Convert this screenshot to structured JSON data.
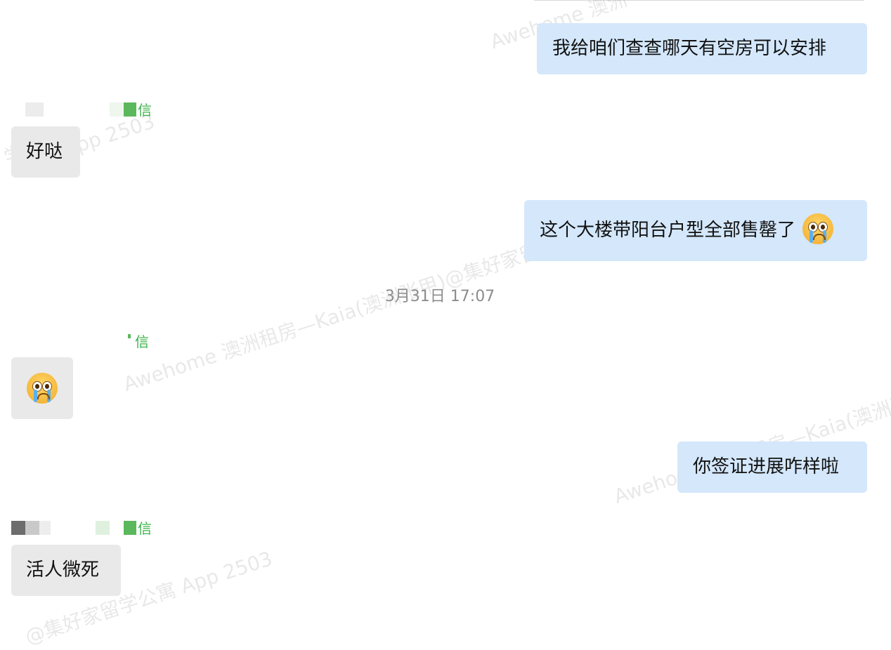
{
  "conversation": {
    "messages": [
      {
        "direction": "outgoing",
        "text": "我给咱们查查哪天有空房可以安排"
      },
      {
        "direction": "incoming",
        "sender_label": "信",
        "text": "好哒"
      },
      {
        "direction": "outgoing",
        "text": "这个大楼带阳台户型全部售罄了",
        "emoji": "crying-face-emoji"
      },
      {
        "direction": "system",
        "text": "3月31日 17:07"
      },
      {
        "direction": "incoming",
        "sender_label": "信",
        "emoji": "crying-face-emoji"
      },
      {
        "direction": "outgoing",
        "text": "你签证进展咋样啦"
      },
      {
        "direction": "incoming",
        "sender_label": "信",
        "text": "活人微死"
      }
    ]
  },
  "watermarks": [
    "Awehome 澳洲",
    "学",
    "pp 2503",
    "Awehome 澳洲租房—Kaia(澳洲张甲)@集好家留学公",
    "Awehome 澳洲租房—Kaia(澳洲张甲)",
    "@集好家留学公寓 App 2503"
  ],
  "colors": {
    "outgoing_bubble": "#d4e7fb",
    "incoming_bubble": "#e9e9e9",
    "sender_label": "#3bb34a",
    "timestamp": "#8c8c8c"
  }
}
